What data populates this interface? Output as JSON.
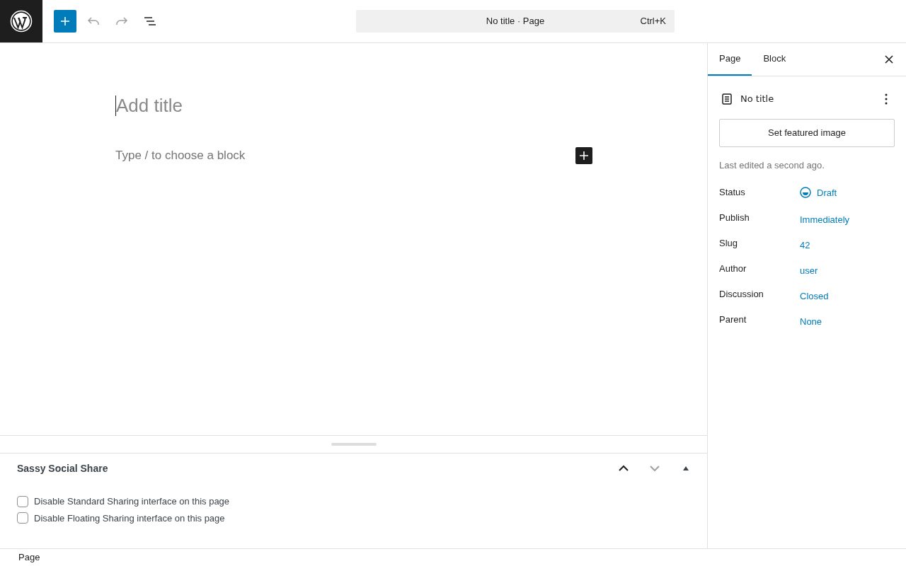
{
  "toolbar": {
    "undo": {
      "disabled": true
    },
    "redo": {
      "disabled": true
    },
    "command_bar": {
      "title": "No title · Page",
      "shortcut": "Ctrl+K"
    }
  },
  "editor": {
    "title_placeholder": "Add title",
    "block_placeholder": "Type / to choose a block"
  },
  "meta_box": {
    "title": "Sassy Social Share",
    "move_up": {
      "disabled": false
    },
    "move_down": {
      "disabled": true
    },
    "expanded": true,
    "options": [
      {
        "label": "Disable Standard Sharing interface on this page",
        "checked": false
      },
      {
        "label": "Disable Floating Sharing interface on this page",
        "checked": false
      }
    ]
  },
  "sidebar": {
    "tabs": [
      {
        "label": "Page",
        "selected": true
      },
      {
        "label": "Block",
        "selected": false
      }
    ],
    "document_title": "No title",
    "featured_image_button": "Set featured image",
    "last_edited": "Last edited a second ago.",
    "fields": [
      {
        "label": "Status",
        "value": "Draft",
        "kind": "status"
      },
      {
        "label": "Publish",
        "value": "Immediately",
        "kind": "link"
      },
      {
        "label": "Slug",
        "value": "42",
        "kind": "link"
      },
      {
        "label": "Author",
        "value": "user",
        "kind": "link"
      },
      {
        "label": "Discussion",
        "value": "Closed",
        "kind": "link"
      },
      {
        "label": "Parent",
        "value": "None",
        "kind": "link"
      }
    ]
  },
  "footer": {
    "breadcrumb": "Page"
  }
}
